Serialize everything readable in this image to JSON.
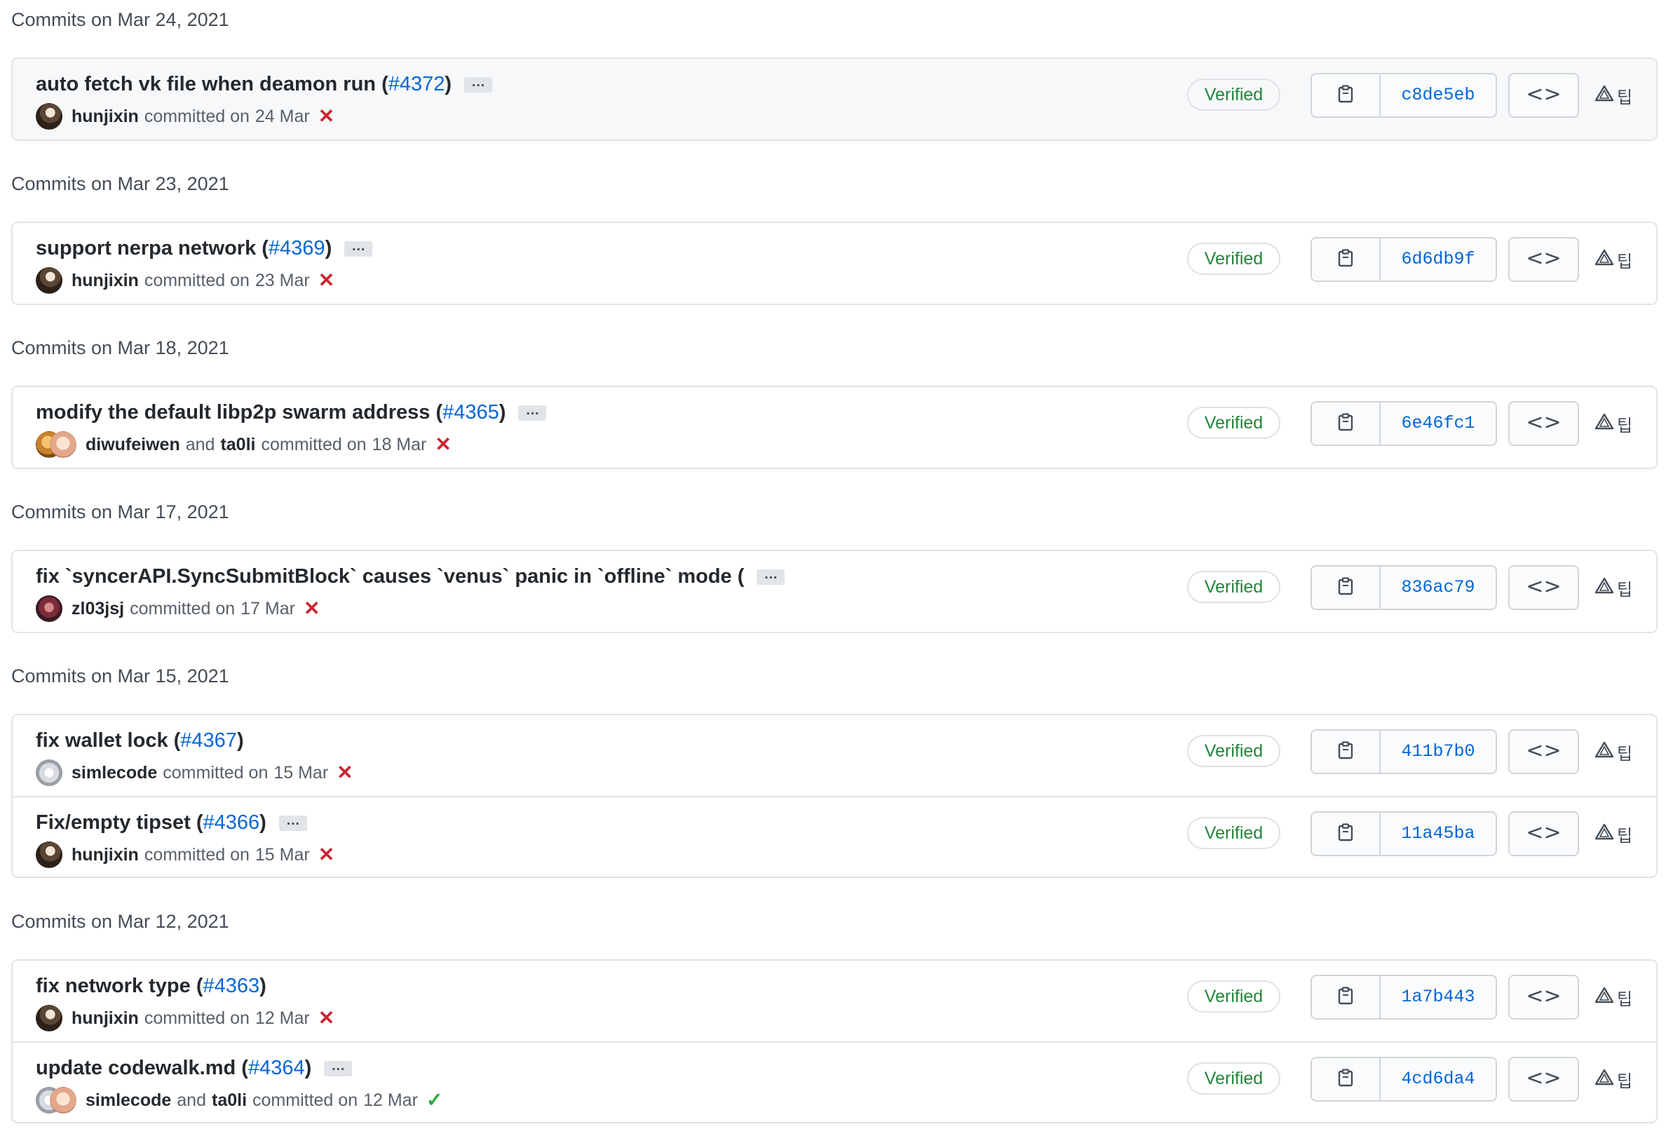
{
  "colors": {
    "link": "#0366d6",
    "verified": "#22863a",
    "fail": "#cb2431",
    "success": "#28a745",
    "border": "#e1e4e8"
  },
  "icons": {
    "copy": "clipboard-icon",
    "browse": "code-icon",
    "extra": "warning-triangle-icon"
  },
  "common": {
    "verified_label": "Verified",
    "committed_on": "committed on",
    "and": "and",
    "ellipsis": "…",
    "browse_glyph": "<>",
    "extra_glyph": "팁"
  },
  "groups": [
    {
      "heading": "Commits on Mar 24, 2021",
      "commits": [
        {
          "title": "auto fetch vk file when deamon run (",
          "pr": "#4372",
          "suffix": ")",
          "has_ellipsis": true,
          "authors": [
            "hunjixin"
          ],
          "date": "24 Mar",
          "status": "fail",
          "sha": "c8de5eb"
        }
      ]
    },
    {
      "heading": "Commits on Mar 23, 2021",
      "commits": [
        {
          "title": "support nerpa network (",
          "pr": "#4369",
          "suffix": ")",
          "has_ellipsis": true,
          "authors": [
            "hunjixin"
          ],
          "date": "23 Mar",
          "status": "fail",
          "sha": "6d6db9f"
        }
      ]
    },
    {
      "heading": "Commits on Mar 18, 2021",
      "commits": [
        {
          "title": "modify the default libp2p swarm address (",
          "pr": "#4365",
          "suffix": ")",
          "has_ellipsis": true,
          "authors": [
            "diwufeiwen",
            "ta0li"
          ],
          "date": "18 Mar",
          "status": "fail",
          "sha": "6e46fc1"
        }
      ]
    },
    {
      "heading": "Commits on Mar 17, 2021",
      "commits": [
        {
          "title": "fix `syncerAPI.SyncSubmitBlock` causes `venus` panic in `offline` mode (",
          "pr": "",
          "suffix": "",
          "has_ellipsis": true,
          "authors": [
            "zl03jsj"
          ],
          "date": "17 Mar",
          "status": "fail",
          "sha": "836ac79"
        }
      ]
    },
    {
      "heading": "Commits on Mar 15, 2021",
      "commits": [
        {
          "title": "fix wallet lock (",
          "pr": "#4367",
          "suffix": ")",
          "has_ellipsis": false,
          "authors": [
            "simlecode"
          ],
          "date": "15 Mar",
          "status": "fail",
          "sha": "411b7b0"
        },
        {
          "title": "Fix/empty tipset (",
          "pr": "#4366",
          "suffix": ")",
          "has_ellipsis": true,
          "authors": [
            "hunjixin"
          ],
          "date": "15 Mar",
          "status": "fail",
          "sha": "11a45ba"
        }
      ]
    },
    {
      "heading": "Commits on Mar 12, 2021",
      "commits": [
        {
          "title": "fix network type (",
          "pr": "#4363",
          "suffix": ")",
          "has_ellipsis": false,
          "authors": [
            "hunjixin"
          ],
          "date": "12 Mar",
          "status": "fail",
          "sha": "1a7b443"
        },
        {
          "title": "update codewalk.md (",
          "pr": "#4364",
          "suffix": ")",
          "has_ellipsis": true,
          "authors": [
            "simlecode",
            "ta0li"
          ],
          "date": "12 Mar",
          "status": "ok",
          "sha": "4cd6da4"
        }
      ]
    }
  ]
}
